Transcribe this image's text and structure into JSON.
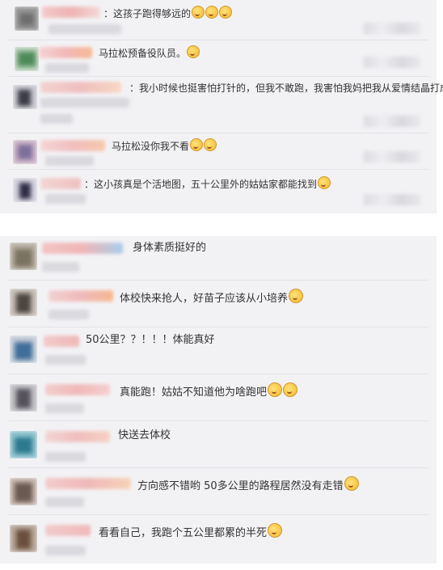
{
  "comments_top": [
    {
      "text": "：这孩子跑得够远的",
      "emoji_count": 3
    },
    {
      "text": "马拉松预备役队员。",
      "emoji_count": 1
    },
    {
      "text": "：我小时候也挺害怕打针的，但我不敢跑，我害怕我妈把我从爱情结晶打成爱",
      "emoji_count": 0
    },
    {
      "text": "马拉松没你我不看",
      "emoji_count": 2
    },
    {
      "text": "：这小孩真是个活地图，五十公里外的姑姑家都能找到",
      "emoji_count": 1
    }
  ],
  "comments_bottom": [
    {
      "text": "身体素质挺好的",
      "emoji_count": 0
    },
    {
      "text": "体校快来抢人，好苗子应该从小培养",
      "emoji_count": 1
    },
    {
      "text": "50公里？？！！！体能真好",
      "emoji_count": 0
    },
    {
      "text": "真能跑！姑姑不知道他为啥跑吧",
      "emoji_count": 2
    },
    {
      "text": "快送去体校",
      "emoji_count": 0
    },
    {
      "text": "方向感不错哟  50多公里的路程居然没有走错",
      "emoji_count": 1
    },
    {
      "text": "看看自己，我跑个五公里都累的半死",
      "emoji_count": 1
    }
  ],
  "icons": {
    "emoji": "laughing-emoji-icon"
  }
}
